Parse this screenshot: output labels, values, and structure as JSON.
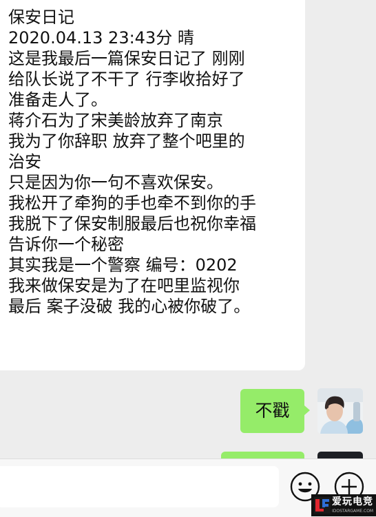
{
  "chat": {
    "incoming_message": {
      "lines": [
        "保安日记",
        "2020.04.13 23:43分 晴",
        "这是我最后一篇保安日记了 刚刚",
        "给队长说了不干了 行李收拾好了",
        "准备走人了。",
        "蒋介石为了宋美龄放弃了南京",
        "我为了你辞职 放弃了整个吧里的",
        "治安",
        "只是因为你一句不喜欢保安。",
        "我松开了牵狗的手也牵不到你的手",
        "我脱下了保安制服最后也祝你幸福",
        "告诉你一个秘密",
        "其实我是一个警察 编号：0202",
        "我来做保安是为了在吧里监视你",
        "最后 案子没破 我的心被你破了。"
      ]
    },
    "outgoing_message": {
      "text": "不戳"
    }
  },
  "input_bar": {
    "value": "",
    "emoji_icon": "emoji-icon",
    "plus_icon": "plus-icon"
  },
  "watermark": {
    "brand_text": "爱玩电竞",
    "url_text": "IDOSTARGAME.COM"
  },
  "colors": {
    "chat_background": "#ededed",
    "incoming_bubble": "#ffffff",
    "outgoing_bubble": "#95ec69",
    "input_bar": "#f7f7f7"
  }
}
